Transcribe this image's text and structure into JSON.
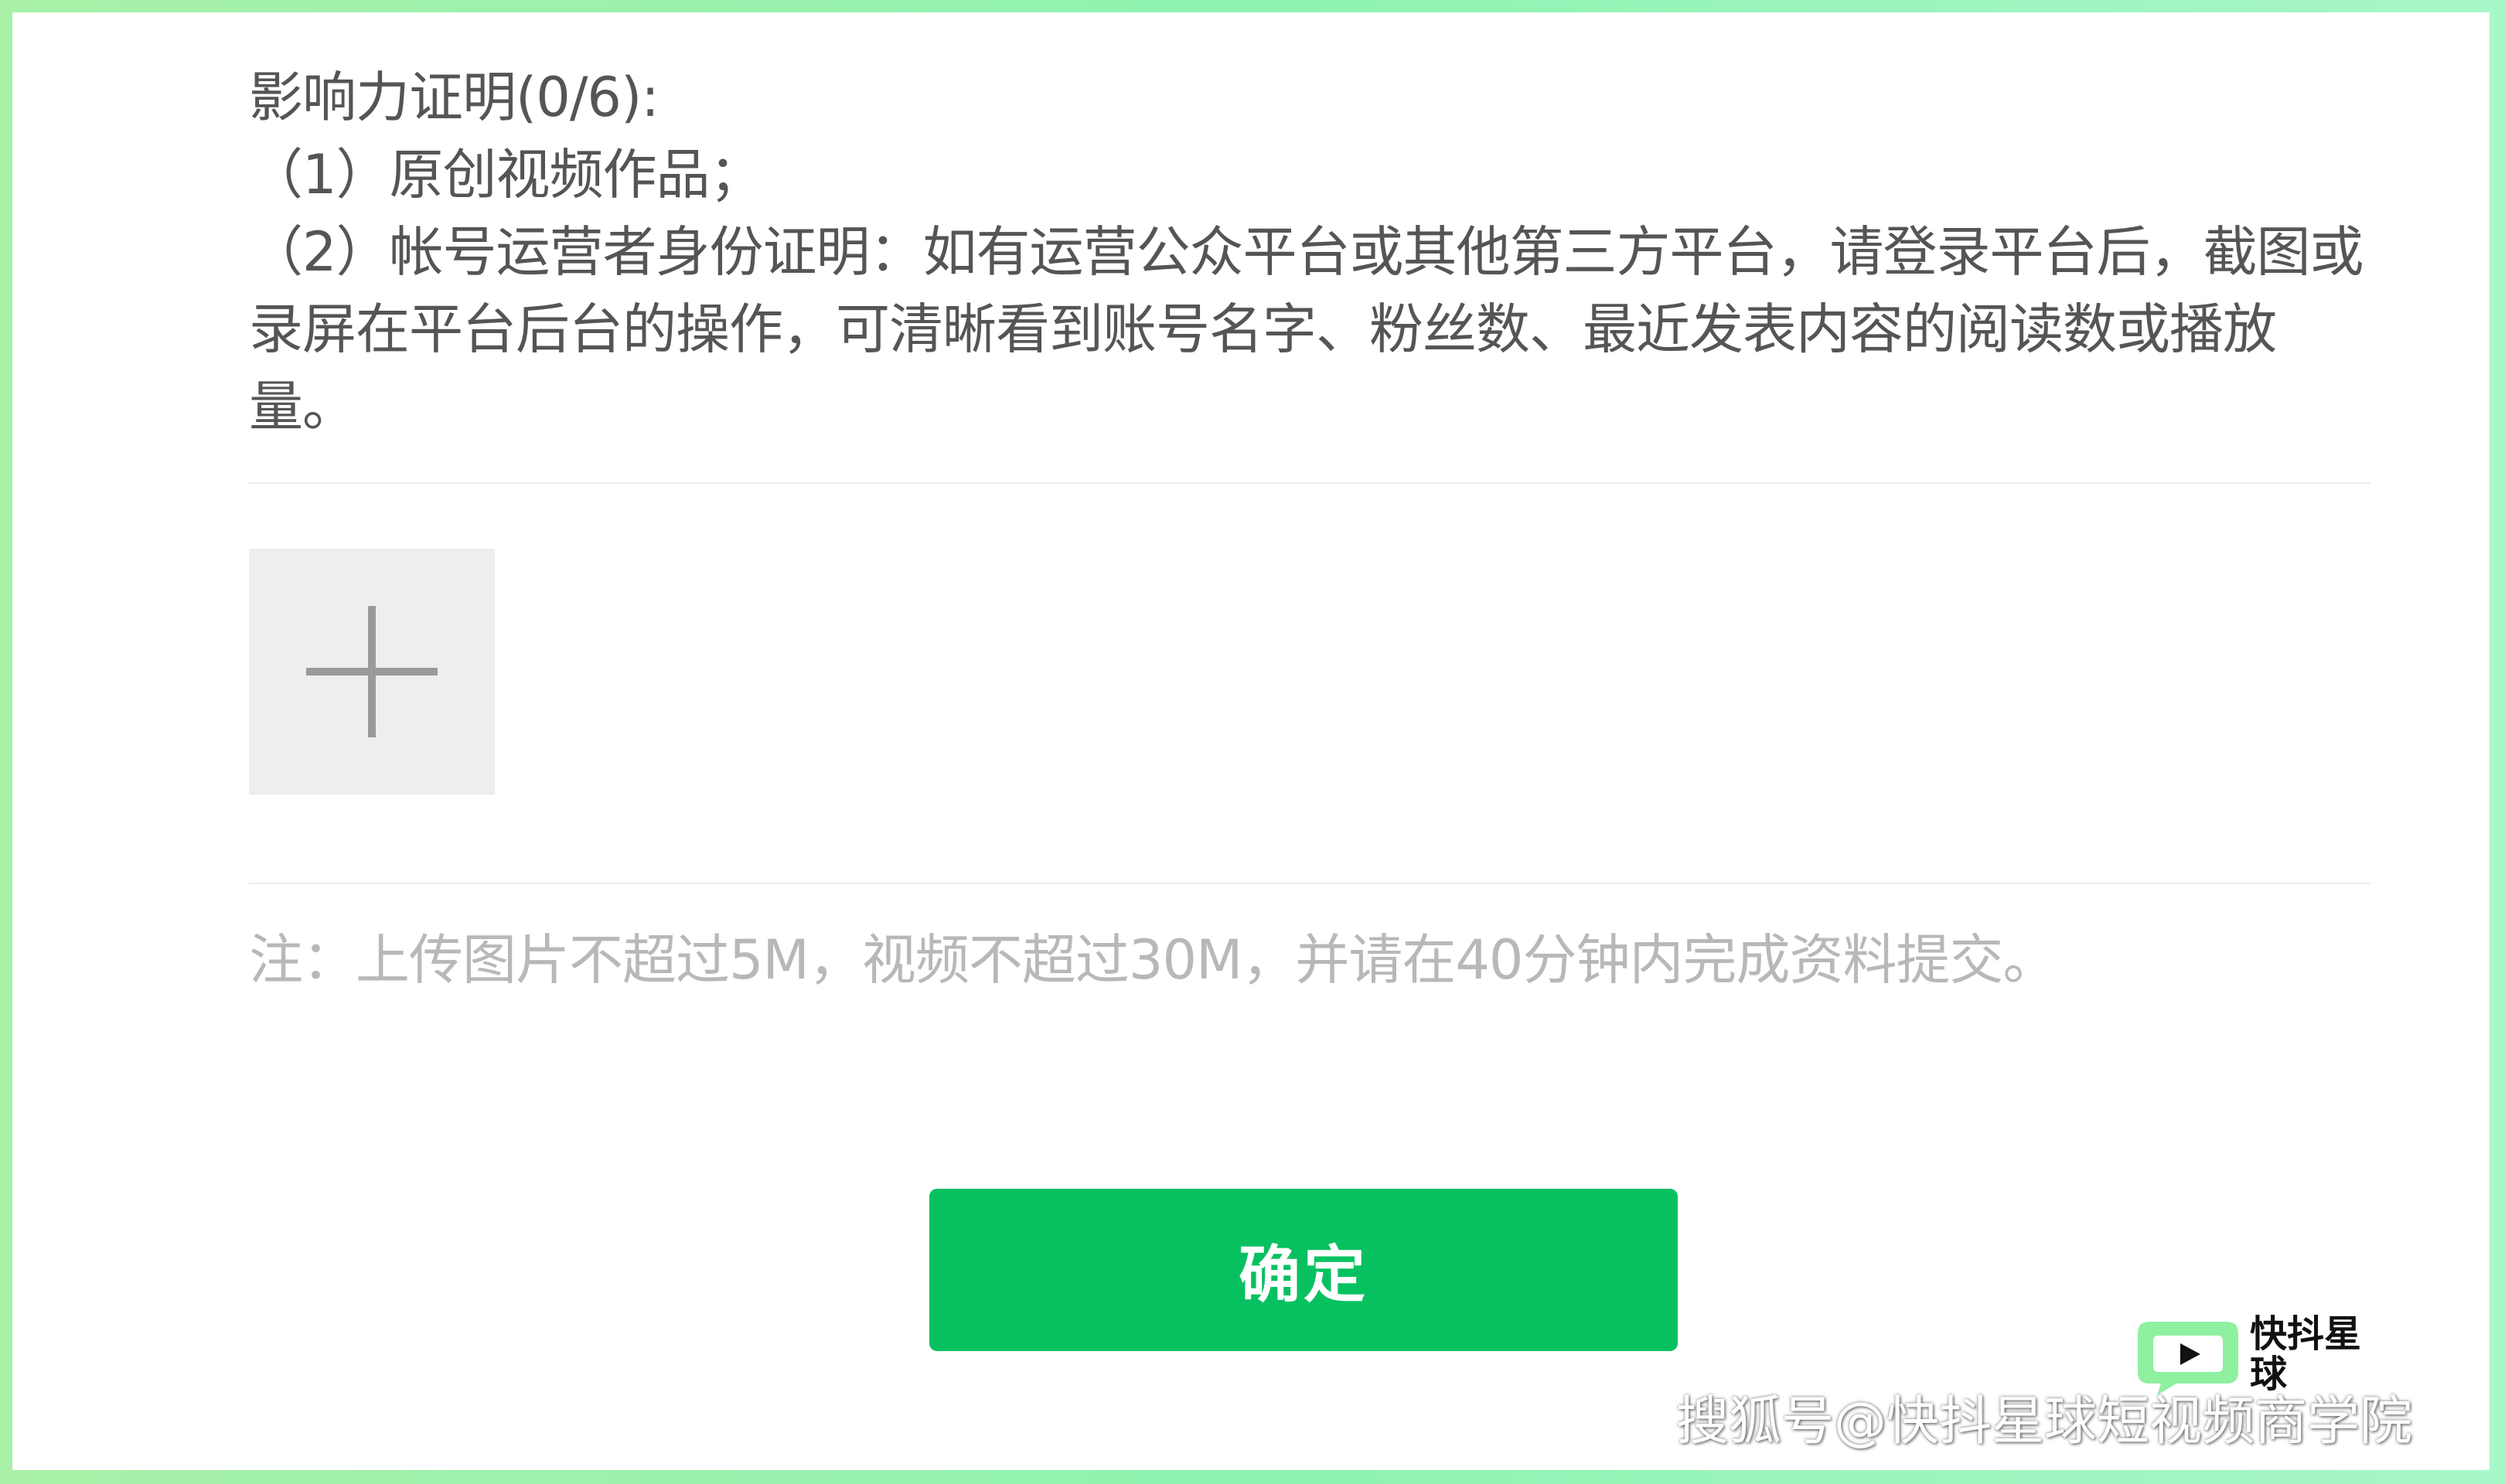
{
  "proof": {
    "heading": "影响力证明(0/6):",
    "items": [
      "（1）原创视频作品；",
      "（2）帐号运营者身份证明：如有运营公众平台或其他第三方平台，请登录平台后，截图或录屏在平台后台的操作，可清晰看到账号名字、粉丝数、最近发表内容的阅读数或播放量。"
    ]
  },
  "upload": {
    "icon": "plus-icon"
  },
  "note": "注：上传图片不超过5M，视频不超过30M，并请在40分钟内完成资料提交。",
  "confirm_label": "确定",
  "watermark": {
    "logo_text": "快抖星球",
    "text": "搜狐号@快抖星球短视频商学院"
  },
  "colors": {
    "accent": "#07c160",
    "text": "#555555",
    "note": "#b8b8b8",
    "tile": "#eeeeee"
  }
}
